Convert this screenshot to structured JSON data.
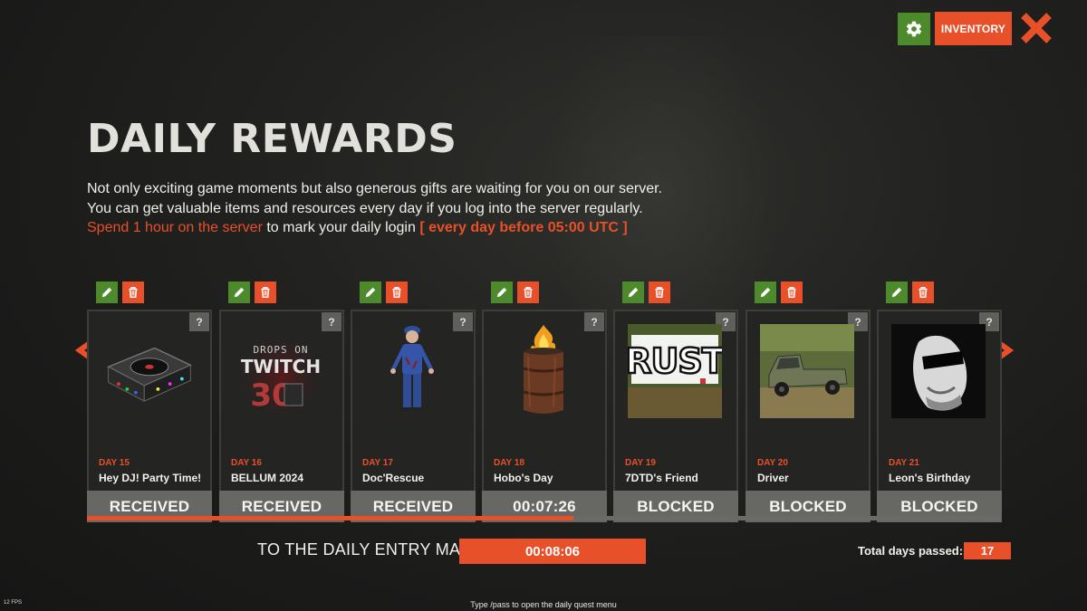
{
  "header": {
    "inventory_label": "INVENTORY",
    "settings_icon": "gear-icon",
    "close_icon": "close-x-icon"
  },
  "page": {
    "title": "DAILY REWARDS",
    "desc_line1": "Not only exciting game moments but also generous gifts are waiting for you on our server.",
    "desc_line2": "You can get valuable items and resources every day if you log into the server regularly.",
    "desc_line3_highlight": "Spend 1 hour on the server",
    "desc_line3_text": " to mark your daily login ",
    "desc_line3_bracket": "[ every day before 05:00 UTC ]"
  },
  "colors": {
    "accent": "#e8502a",
    "green": "#4d8a2c",
    "status_bg": "#676764",
    "card_bg": "#242422"
  },
  "cards": [
    {
      "day": "DAY 15",
      "name": "Hey DJ! Party Time!",
      "status": "RECEIVED",
      "help": "?",
      "art": "dj-box-icon"
    },
    {
      "day": "DAY 16",
      "name": "BELLUM 2024",
      "status": "RECEIVED",
      "help": "?",
      "art": "drops-on-twitch-icon",
      "art_text1": "DROPS ON",
      "art_text2": "TWITCH",
      "art_text3": "30"
    },
    {
      "day": "DAY 17",
      "name": "Doc'Rescue",
      "status": "RECEIVED",
      "help": "?",
      "art": "doctor-figure-icon"
    },
    {
      "day": "DAY 18",
      "name": "Hobo's Day",
      "status": "00:07:26",
      "help": "?",
      "art": "fire-barrel-icon"
    },
    {
      "day": "DAY 19",
      "name": "7DTD's Friend",
      "status": "BLOCKED",
      "help": "?",
      "art": "rust-sign-icon",
      "art_text1": "RUST"
    },
    {
      "day": "DAY 20",
      "name": "Driver",
      "status": "BLOCKED",
      "help": "?",
      "art": "truck-icon"
    },
    {
      "day": "DAY 21",
      "name": "Leon's Birthday",
      "status": "BLOCKED",
      "help": "?",
      "art": "leon-portrait-icon"
    }
  ],
  "progress": {
    "fraction": 0.532
  },
  "footer": {
    "entry_label": "TO THE DAILY ENTRY MARK:",
    "entry_timer": "00:08:06",
    "days_label": "Total days passed:",
    "days_value": "17",
    "fps": "12 FPS",
    "hint": "Type /pass to open the daily quest menu"
  }
}
